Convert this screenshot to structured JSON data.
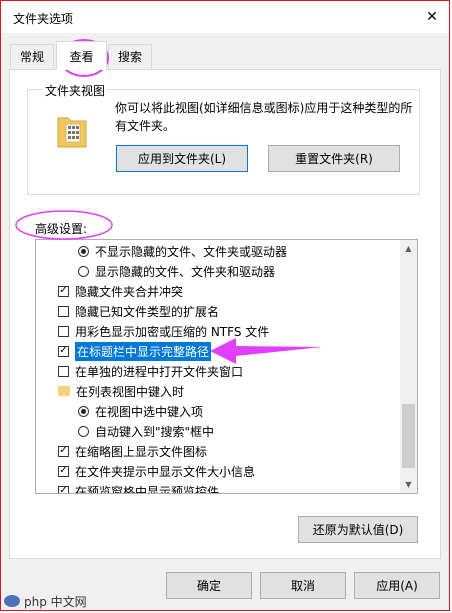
{
  "window": {
    "title": "文件夹选项",
    "close_glyph": "✕"
  },
  "tabs": [
    {
      "label": "常规",
      "active": false
    },
    {
      "label": "查看",
      "active": true
    },
    {
      "label": "搜索",
      "active": false
    }
  ],
  "folder_views": {
    "label": "文件夹视图",
    "description": "你可以将此视图(如详细信息或图标)应用于这种类型的所有文件夹。",
    "apply_button": "应用到文件夹(L)",
    "reset_button": "重置文件夹(R)"
  },
  "advanced": {
    "label": "高级设置:",
    "items": [
      {
        "type": "radio",
        "indent": 2,
        "checked": true,
        "label": "不显示隐藏的文件、文件夹或驱动器"
      },
      {
        "type": "radio",
        "indent": 2,
        "checked": false,
        "label": "显示隐藏的文件、文件夹和驱动器"
      },
      {
        "type": "checkbox",
        "indent": 1,
        "checked": true,
        "label": "隐藏文件夹合并冲突"
      },
      {
        "type": "checkbox",
        "indent": 1,
        "checked": false,
        "label": "隐藏已知文件类型的扩展名"
      },
      {
        "type": "checkbox",
        "indent": 1,
        "checked": false,
        "label": "用彩色显示加密或压缩的 NTFS 文件"
      },
      {
        "type": "checkbox",
        "indent": 1,
        "checked": true,
        "label": "在标题栏中显示完整路径",
        "selected": true
      },
      {
        "type": "checkbox",
        "indent": 1,
        "checked": false,
        "label": "在单独的进程中打开文件夹窗口"
      },
      {
        "type": "folder",
        "indent": 1,
        "label": "在列表视图中键入时"
      },
      {
        "type": "radio",
        "indent": 2,
        "checked": true,
        "label": "在视图中选中键入项"
      },
      {
        "type": "radio",
        "indent": 2,
        "checked": false,
        "label": "自动键入到\"搜索\"框中"
      },
      {
        "type": "checkbox",
        "indent": 1,
        "checked": true,
        "label": "在缩略图上显示文件图标"
      },
      {
        "type": "checkbox",
        "indent": 1,
        "checked": true,
        "label": "在文件夹提示中显示文件大小信息"
      },
      {
        "type": "checkbox",
        "indent": 1,
        "checked": true,
        "label": "在预览窗格中显示预览控件"
      }
    ],
    "restore_defaults_button": "还原为默认值(D)"
  },
  "footer": {
    "ok": "确定",
    "cancel": "取消",
    "apply": "应用(A)"
  },
  "watermark": {
    "text": "php 中文网"
  },
  "colors": {
    "annotation": "#e040fb",
    "selection": "#0078d7",
    "close_border": "#e81123"
  }
}
